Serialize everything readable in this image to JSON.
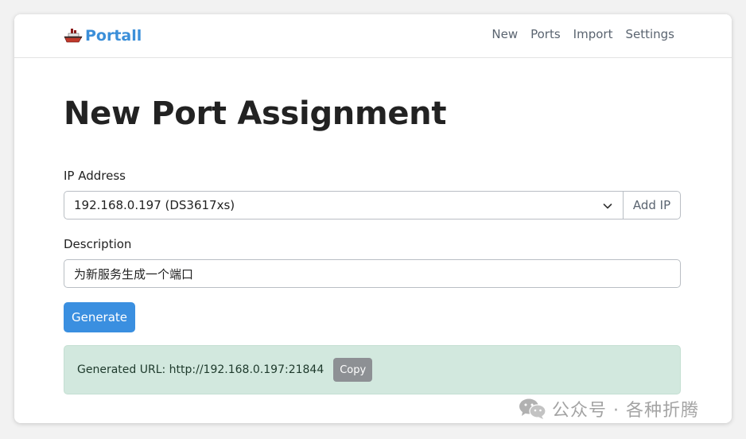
{
  "nav": {
    "brand": "Portall",
    "links": [
      "New",
      "Ports",
      "Import",
      "Settings"
    ]
  },
  "page": {
    "title": "New Port Assignment"
  },
  "form": {
    "ip_label": "IP Address",
    "ip_selected": "192.168.0.197 (DS3617xs)",
    "add_ip_label": "Add IP",
    "description_label": "Description",
    "description_value": "为新服务生成一个端口",
    "generate_label": "Generate"
  },
  "result": {
    "text": "Generated URL: http://192.168.0.197:21844",
    "copy_label": "Copy"
  },
  "watermark": {
    "text": "公众号 · 各种折腾"
  },
  "colors": {
    "brand": "#3b8fd9",
    "primary": "#3a8fe0",
    "alert_bg": "#d2e8de",
    "copy_bg": "#8d9094"
  },
  "icons": {
    "brand": "ship-icon",
    "select": "chevron-down-icon",
    "watermark": "wechat-icon"
  }
}
